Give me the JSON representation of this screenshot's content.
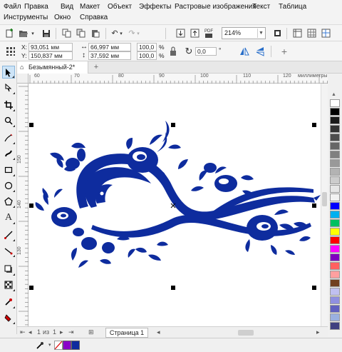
{
  "menu": [
    "Файл",
    "Правка",
    "Вид",
    "Макет",
    "Объект",
    "Эффекты",
    "Растровые изображения",
    "Текст",
    "Таблица",
    "Инструменты",
    "Окно",
    "Справка"
  ],
  "toolbar": {
    "zoom": "214%",
    "pdf_label": "PDF"
  },
  "props": {
    "x_label": "X:",
    "x_value": "93,051 мм",
    "y_label": "Y:",
    "y_value": "150,837 мм",
    "w_value": "66,997 мм",
    "h_value": "37,592 мм",
    "scale_w": "100,0",
    "scale_h": "100,0",
    "percent": "%",
    "angle": "0,0",
    "degree": "°"
  },
  "doc_tab": {
    "title": "Безымянный-2*",
    "add": "+"
  },
  "rulers": {
    "unit": "миллиметры",
    "h_ticks": [
      "60",
      "70",
      "80",
      "90",
      "100",
      "110",
      "120"
    ],
    "v_ticks": [
      "150",
      "140",
      "130"
    ]
  },
  "pager": {
    "position": "1",
    "of": "из",
    "total": "1",
    "page_name": "Страница 1"
  },
  "artwork": {
    "color": "#0e2c9e"
  },
  "palette": [
    "#ffffff",
    "#000000",
    "#1a1a1a",
    "#333333",
    "#4d4d4d",
    "#666666",
    "#808080",
    "#999999",
    "#b3b3b3",
    "#cccccc",
    "#e6e6e6",
    "#f2f2f2",
    "#0000ff",
    "#00b0f0",
    "#00c060",
    "#ffff00",
    "#ff0000",
    "#ff00ff",
    "#8000c0",
    "#ff6060",
    "#ffa0a0",
    "#704020",
    "#c0c0f0",
    "#9090e0",
    "#6060c0",
    "#9ab0e0",
    "#404080"
  ]
}
